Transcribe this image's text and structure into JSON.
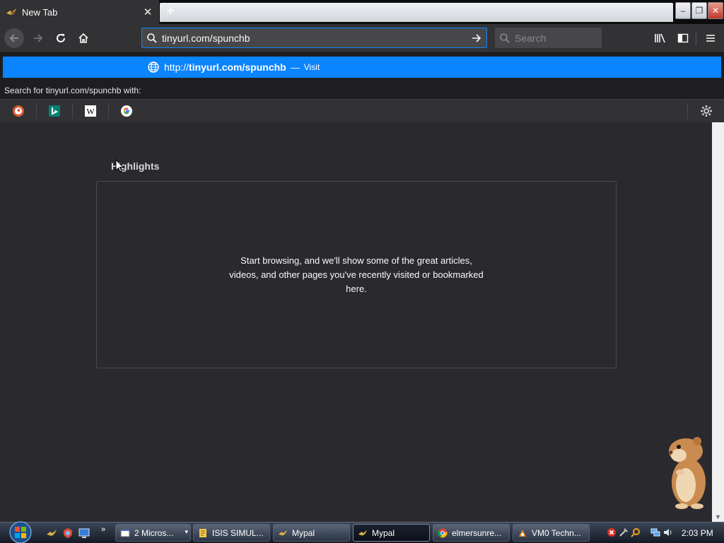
{
  "browser": {
    "tab": {
      "title": "New Tab",
      "close_symbol": "✕"
    },
    "new_tab_symbol": "+",
    "window_controls": {
      "minimize": "‒",
      "restore": "❐",
      "close": "✕"
    },
    "url_bar": {
      "value": "tinyurl.com/spunchb"
    },
    "search_bar": {
      "placeholder": "Search"
    }
  },
  "autocomplete": {
    "url_prefix": "http://",
    "url_bold": "tinyurl.com/spunchb",
    "dash": "—",
    "action": "Visit",
    "search_with": "Search for tinyurl.com/spunchb with:",
    "engines": [
      {
        "name": "duckduckgo-icon",
        "color": "#de5833"
      },
      {
        "name": "bing-icon",
        "color": "#008373"
      },
      {
        "name": "wikipedia-icon",
        "color": "#ffffff"
      },
      {
        "name": "google-icon",
        "color": "#4285f4"
      }
    ]
  },
  "content": {
    "highlights_title": "Highlights",
    "empty_message": "Start browsing, and we'll show some of the great articles, videos, and other pages you've recently visited or bookmarked here."
  },
  "taskbar": {
    "chevron": "»",
    "tasks": [
      {
        "label": "2 Micros...",
        "active": false
      },
      {
        "label": "ISIS SIMUL...",
        "active": false
      },
      {
        "label": "Mypal",
        "active": false
      },
      {
        "label": "Mypal",
        "active": true
      },
      {
        "label": "elmersunre...",
        "active": false
      },
      {
        "label": "VM0 Techn...",
        "active": false
      }
    ],
    "clock": "2:03 PM"
  },
  "colors": {
    "accent": "#0a84ff",
    "toolbar": "#323234",
    "content_bg": "#2a2a2e"
  }
}
